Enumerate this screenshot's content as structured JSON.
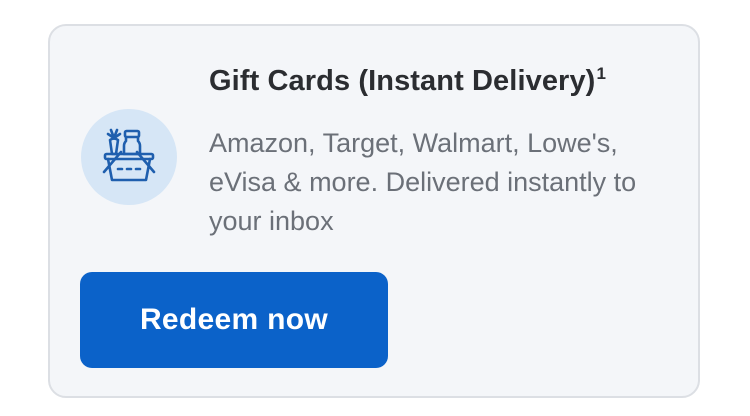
{
  "card": {
    "icon": "gift-basket-icon",
    "title": "Gift Cards (Instant Delivery)",
    "footnote": "1",
    "description": "Amazon, Target, Walmart, Lowe's, eVisa & more. Delivered instantly to your inbox",
    "button_label": "Redeem now"
  },
  "colors": {
    "card_background": "#f4f6f9",
    "card_border": "#dcdfe4",
    "icon_circle": "#d6e6f6",
    "icon_stroke": "#1f5fae",
    "title_text": "#2b2d31",
    "body_text": "#6b7078",
    "button_background": "#0b62c9",
    "button_text": "#ffffff"
  }
}
